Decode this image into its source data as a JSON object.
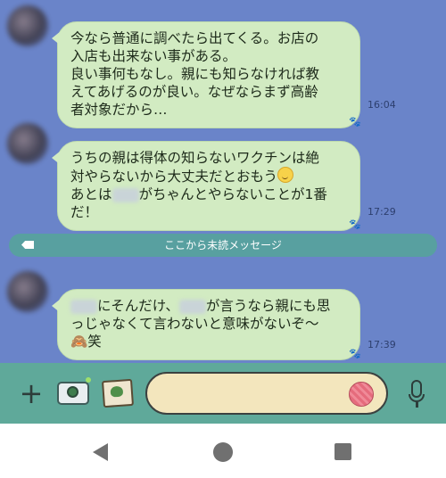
{
  "messages": [
    {
      "lines": [
        "今なら普通に調べたら出てくる。お店の",
        "入店も出来ない事がある。",
        "良い事何もなし。親にも知らなければ教",
        "えてあげるのが良い。なぜならまず高齢",
        "者対象だから…"
      ],
      "time": "16:04"
    },
    {
      "lines": [
        "うちの親は得体の知らないワクチンは絶",
        "対やらないから大丈夫だとおもう"
      ],
      "line3_pre": "あとは",
      "line3_post": "がちゃんとやらないことが1番",
      "line4": "だ！",
      "time": "17:29"
    },
    {
      "line1_post": "にそんだけ、",
      "line1_post2": "が言うなら親にも思",
      "line2": "っじゃなくて言わないと意味がないぞ〜",
      "line3": "🙈笑",
      "time": "17:39"
    }
  ],
  "unread_divider": "ここから未読メッセージ",
  "input": {
    "placeholder": ""
  },
  "colors": {
    "chat_background": "#6a84c9",
    "bubble": "#d2ebc2",
    "input_bar": "#5fa99a",
    "divider": "#58a0a0"
  },
  "icons": [
    "plus-icon",
    "camera-icon",
    "photo-icon",
    "yarn-sticker-icon",
    "mic-icon",
    "nav-back-icon",
    "nav-home-icon",
    "nav-recent-icon"
  ]
}
